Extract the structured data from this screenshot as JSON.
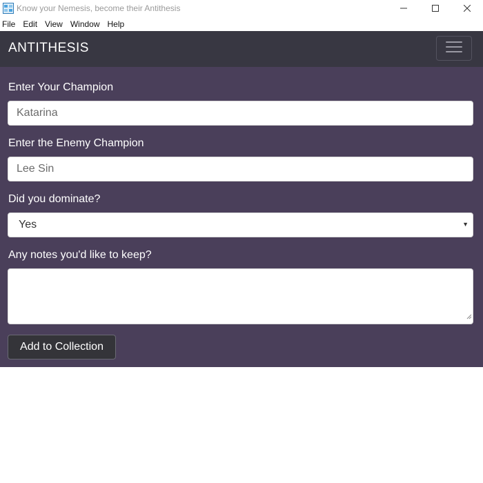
{
  "window": {
    "title": "Know your Nemesis, become their Antithesis",
    "icon": "app-icon",
    "controls": {
      "minimize": "minimize-icon",
      "maximize": "maximize-icon",
      "close": "close-icon"
    }
  },
  "menubar": {
    "items": [
      {
        "label": "File"
      },
      {
        "label": "Edit"
      },
      {
        "label": "View"
      },
      {
        "label": "Window"
      },
      {
        "label": "Help"
      }
    ]
  },
  "navbar": {
    "brand": "ANTITHESIS",
    "toggler_icon": "hamburger-icon"
  },
  "form": {
    "champion": {
      "label": "Enter Your Champion",
      "placeholder": "Katarina"
    },
    "enemy": {
      "label": "Enter the Enemy Champion",
      "placeholder": "Lee Sin"
    },
    "dominate": {
      "label": "Did you dominate?",
      "selected": "Yes"
    },
    "notes": {
      "label": "Any notes you'd like to keep?",
      "value": ""
    },
    "submit_label": "Add to Collection"
  },
  "colors": {
    "navbar_bg": "#383742",
    "main_bg": "#4a3f5a",
    "button_bg": "#343439"
  }
}
